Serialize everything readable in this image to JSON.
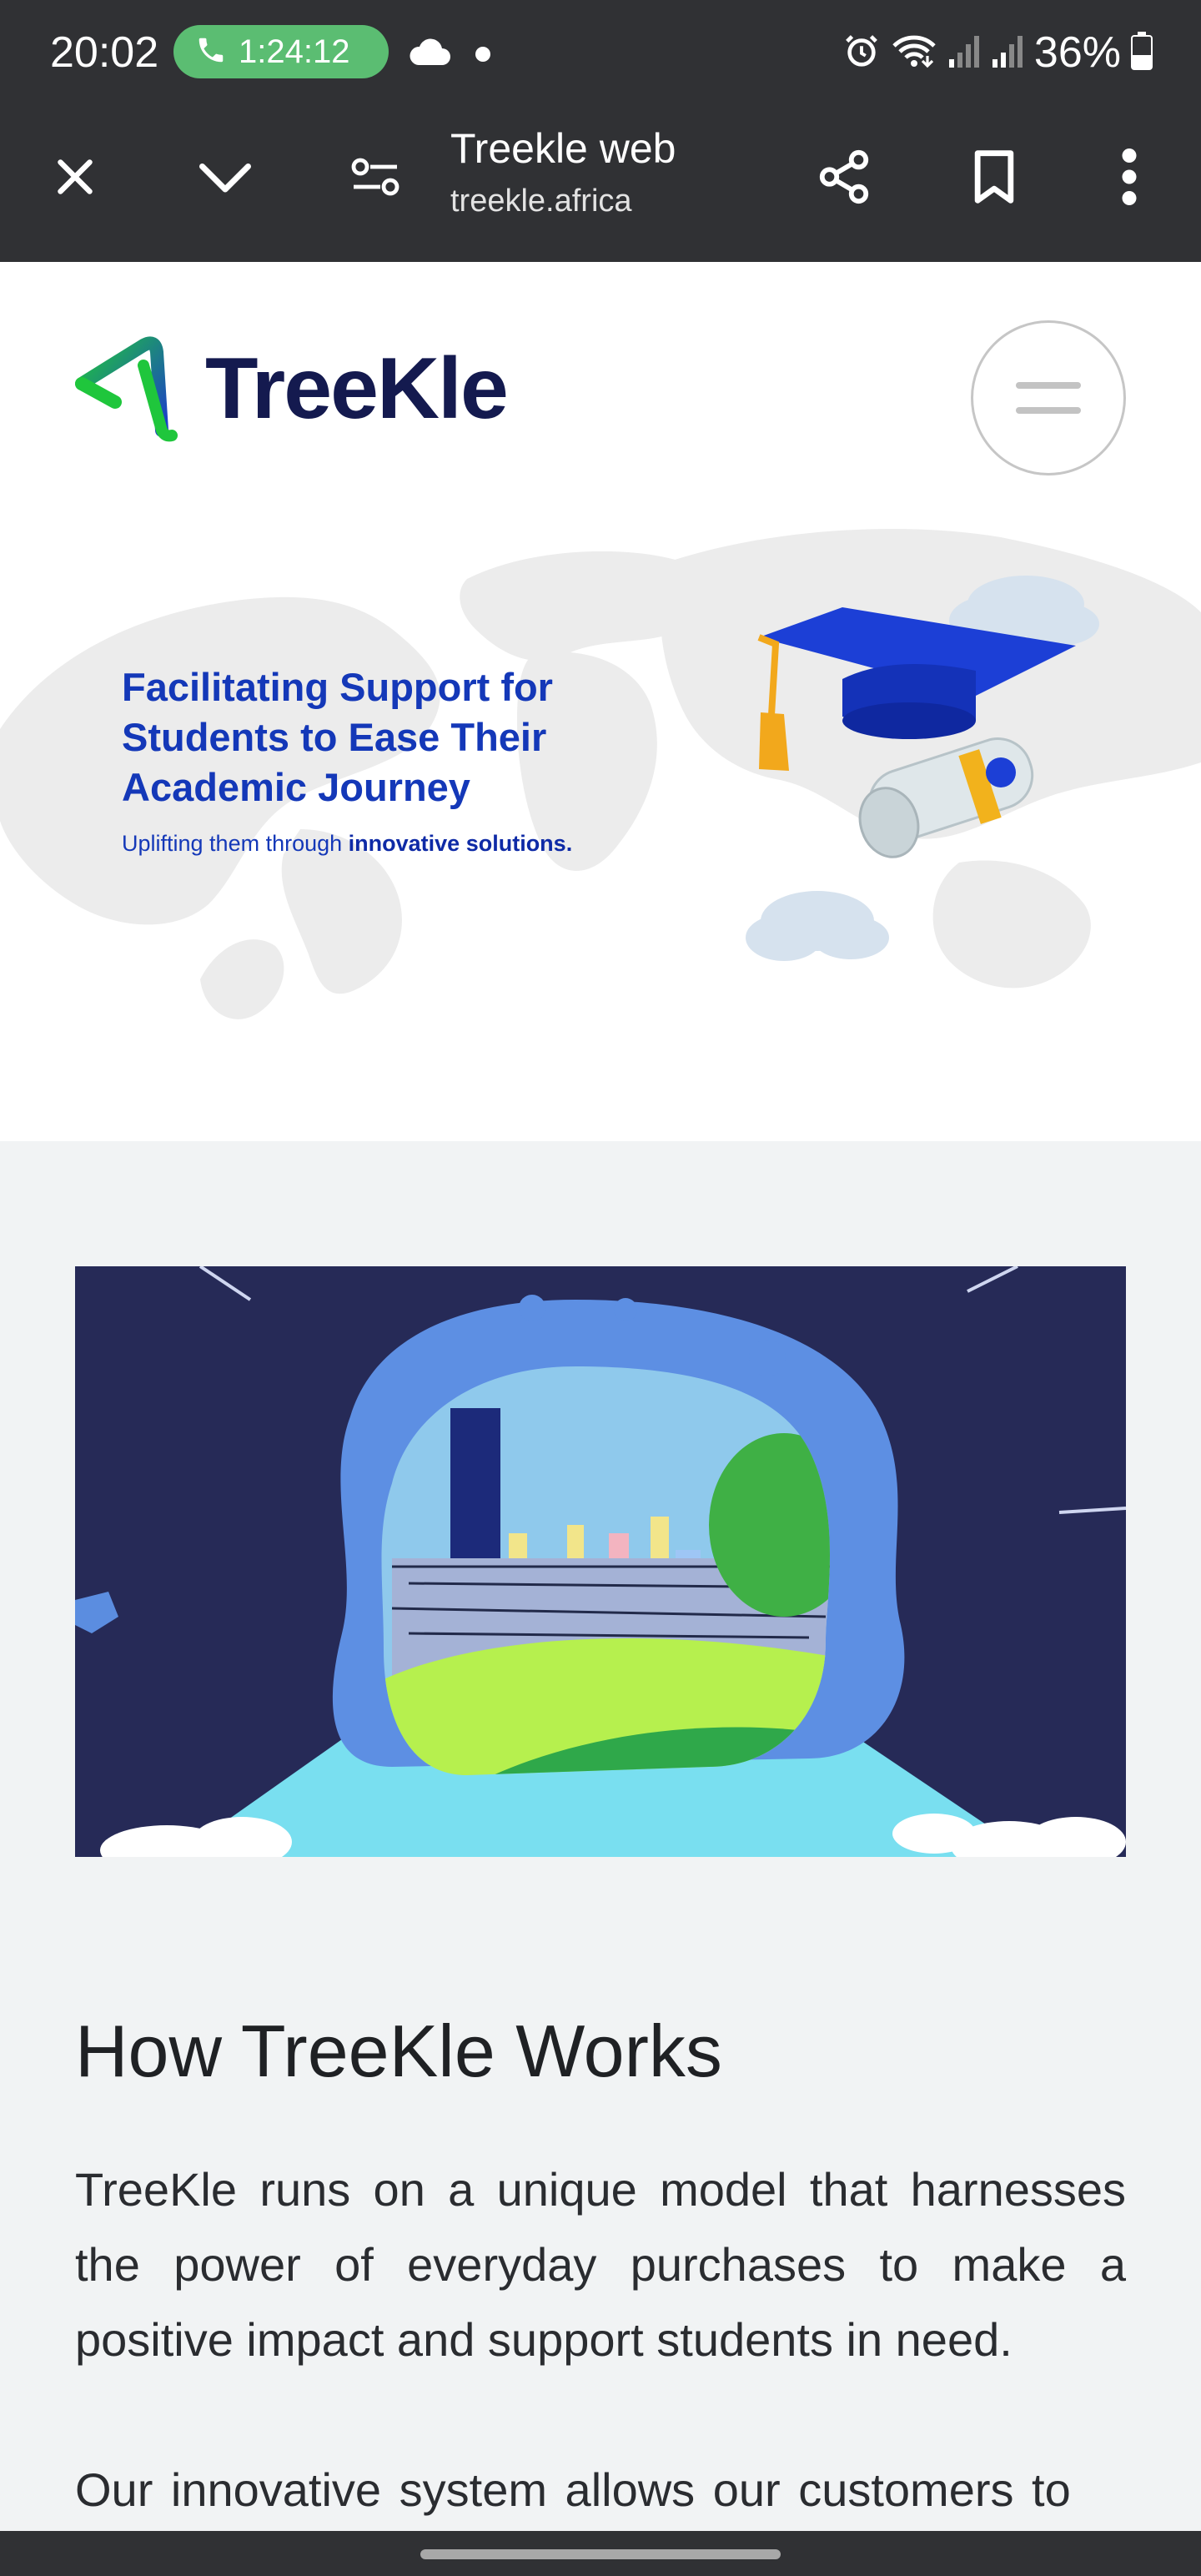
{
  "status_bar": {
    "time": "20:02",
    "call_timer": "1:24:12",
    "battery_percent": "36%",
    "icons": [
      "phone-icon",
      "cloud-icon",
      "alarm-icon",
      "wifi-icon",
      "signal-icon",
      "signal-icon-2",
      "battery-icon"
    ]
  },
  "toolbar": {
    "title": "Treekle web",
    "url": "treekle.africa",
    "icons": [
      "close-icon",
      "chevron-down-icon",
      "site-settings-icon",
      "share-icon",
      "bookmark-icon",
      "more-vert-icon"
    ]
  },
  "site": {
    "logo_text": "TreeKle",
    "brand_colors": {
      "navy": "#141a4f",
      "blue": "#1438b8",
      "green": "#1fc63c"
    },
    "hero": {
      "heading": "Facilitating Support for Students to Ease Their Academic Journey",
      "sub_prefix": "Uplifting them through ",
      "sub_bold": "innovative solutions."
    },
    "section": {
      "title": "How TreeKle Works",
      "paragraphs": [
        "TreeKle runs on a unique model that harnesses the power of everyday purchases to make a positive impact and support students in need.",
        "Our innovative system allows our customers to"
      ]
    }
  }
}
